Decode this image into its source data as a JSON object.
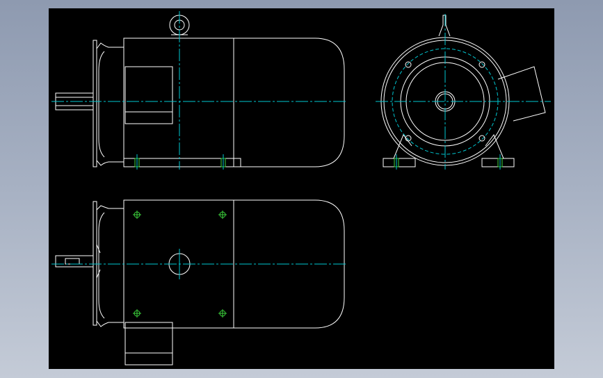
{
  "viewer": {
    "background_color": "#000000",
    "colors": {
      "outline": "#ffffff",
      "centerline": "#00c8d2",
      "hole_marker": "#3cd23c"
    }
  },
  "drawing": {
    "subject": "motor-assembly",
    "views": [
      {
        "id": "side-view",
        "label": ""
      },
      {
        "id": "end-view",
        "label": ""
      },
      {
        "id": "top-view",
        "label": ""
      }
    ]
  }
}
